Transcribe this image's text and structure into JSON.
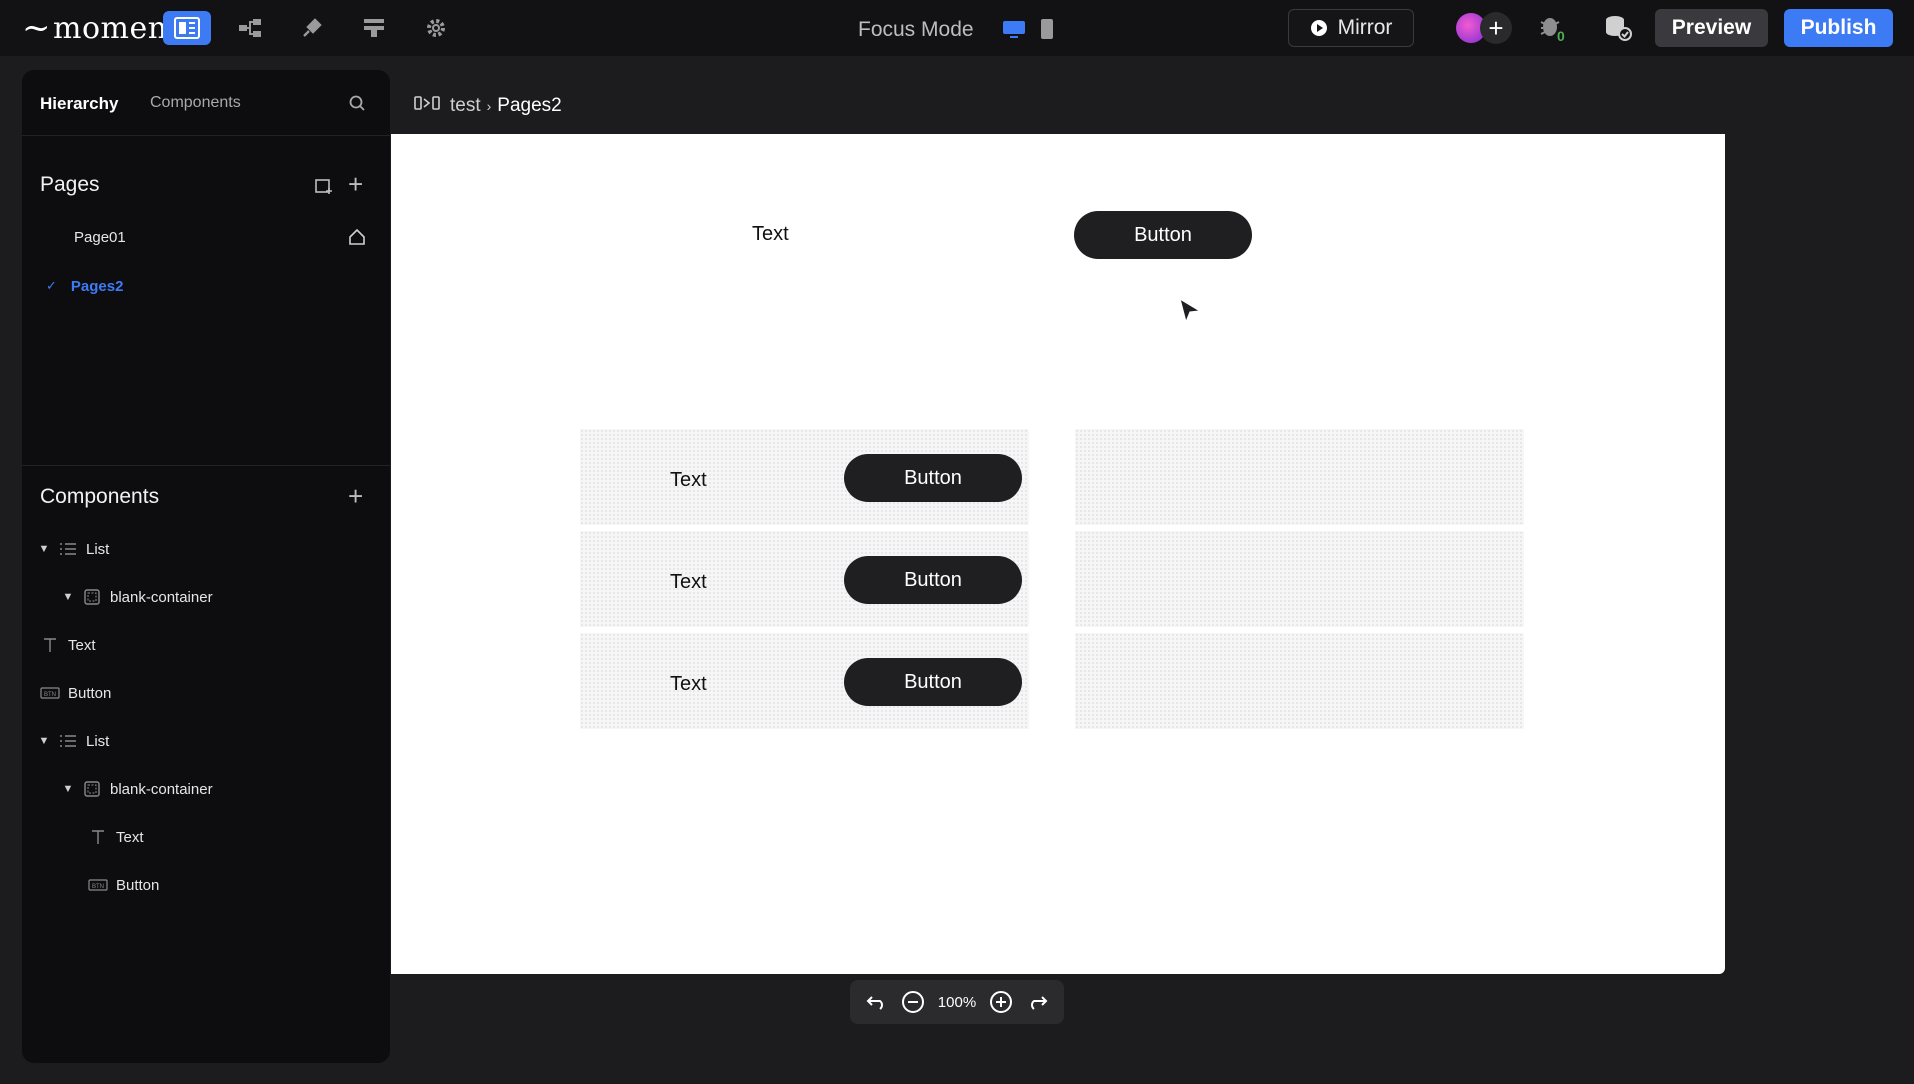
{
  "app": {
    "logo": "momen"
  },
  "topbar": {
    "focus_mode": "Focus Mode",
    "mirror": "Mirror",
    "debug_count": "0",
    "preview": "Preview",
    "publish": "Publish",
    "accent": "#3d7bf5"
  },
  "left_panel": {
    "tabs": [
      "Hierarchy",
      "Components"
    ],
    "pages_title": "Pages",
    "pages": [
      {
        "label": "Page01",
        "selected": false
      },
      {
        "label": "Pages2",
        "selected": true
      }
    ],
    "components_title": "Components",
    "tree": [
      {
        "label": "List",
        "icon": "list-icon",
        "depth": 0,
        "expanded": true
      },
      {
        "label": "blank-container",
        "icon": "container-icon",
        "depth": 1,
        "expanded": true
      },
      {
        "label": "Text",
        "icon": "text-icon",
        "depth": 0
      },
      {
        "label": "Button",
        "icon": "button-icon",
        "depth": 0
      },
      {
        "label": "List",
        "icon": "list-icon",
        "depth": 0,
        "expanded": true
      },
      {
        "label": "blank-container",
        "icon": "container-icon",
        "depth": 1,
        "expanded": true
      },
      {
        "label": "Text",
        "icon": "text-icon",
        "depth": 2
      },
      {
        "label": "Button",
        "icon": "button-icon",
        "depth": 2
      }
    ]
  },
  "breadcrumb": {
    "project": "test",
    "page": "Pages2"
  },
  "canvas": {
    "top_text": "Text",
    "top_button": "Button",
    "list_rows": [
      {
        "text": "Text",
        "button": "Button"
      },
      {
        "text": "Text",
        "button": "Button"
      },
      {
        "text": "Text",
        "button": "Button"
      }
    ]
  },
  "zoom": {
    "level": "100%"
  }
}
